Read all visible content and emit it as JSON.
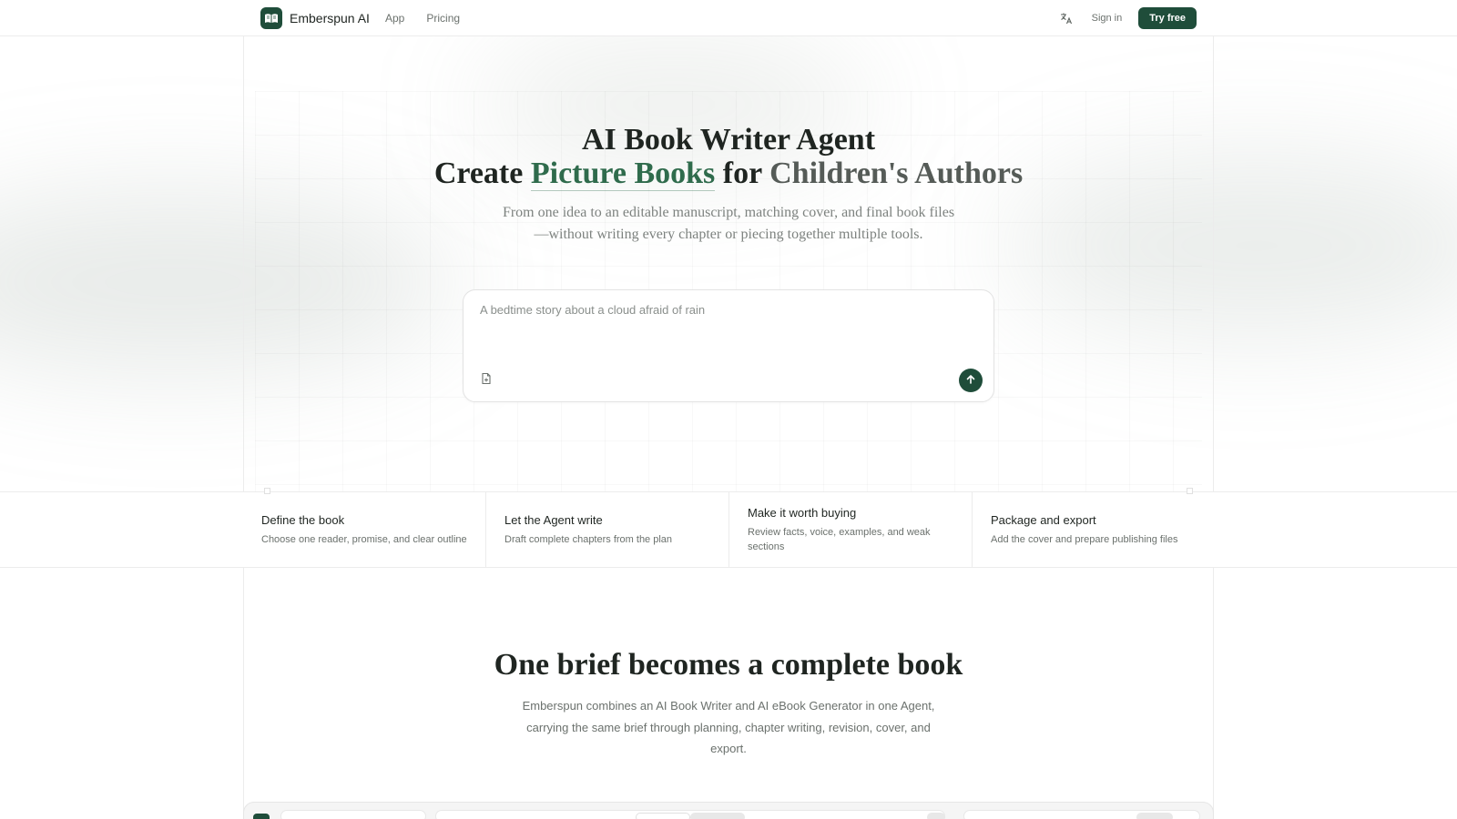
{
  "header": {
    "brand": "Emberspun AI",
    "nav": [
      "App",
      "Pricing"
    ],
    "signin": "Sign in",
    "cta": "Try free"
  },
  "hero": {
    "title_line1": "AI Book Writer Agent",
    "title_line2_prefix": "Create",
    "title_line2_accent": "Picture Books",
    "title_line2_mid": "for",
    "title_line2_audience": "Children's Authors",
    "subtitle": "From one idea to an editable manuscript, matching cover, and final book files—without writing every chapter or piecing together multiple tools.",
    "prompt_placeholder": "A bedtime story about a cloud afraid of rain"
  },
  "features": [
    {
      "title": "Define the book",
      "desc": "Choose one reader, promise, and clear outline"
    },
    {
      "title": "Let the Agent write",
      "desc": "Draft complete chapters from the plan"
    },
    {
      "title": "Make it worth buying",
      "desc": "Review facts, voice, examples, and weak sections"
    },
    {
      "title": "Package and export",
      "desc": "Add the cover and prepare publishing files"
    }
  ],
  "section2": {
    "title": "One brief becomes a complete book",
    "subtitle": "Emberspun combines an AI Book Writer and AI eBook Generator in one Agent, carrying the same brief through planning, chapter writing, revision, cover, and export."
  },
  "colors": {
    "accent": "#1f4d3a",
    "accent_text": "#2f6b4c"
  },
  "icons": {
    "logo": "open-book-icon",
    "translate": "translate-icon",
    "attach": "file-attach-icon",
    "send": "arrow-up-icon"
  }
}
